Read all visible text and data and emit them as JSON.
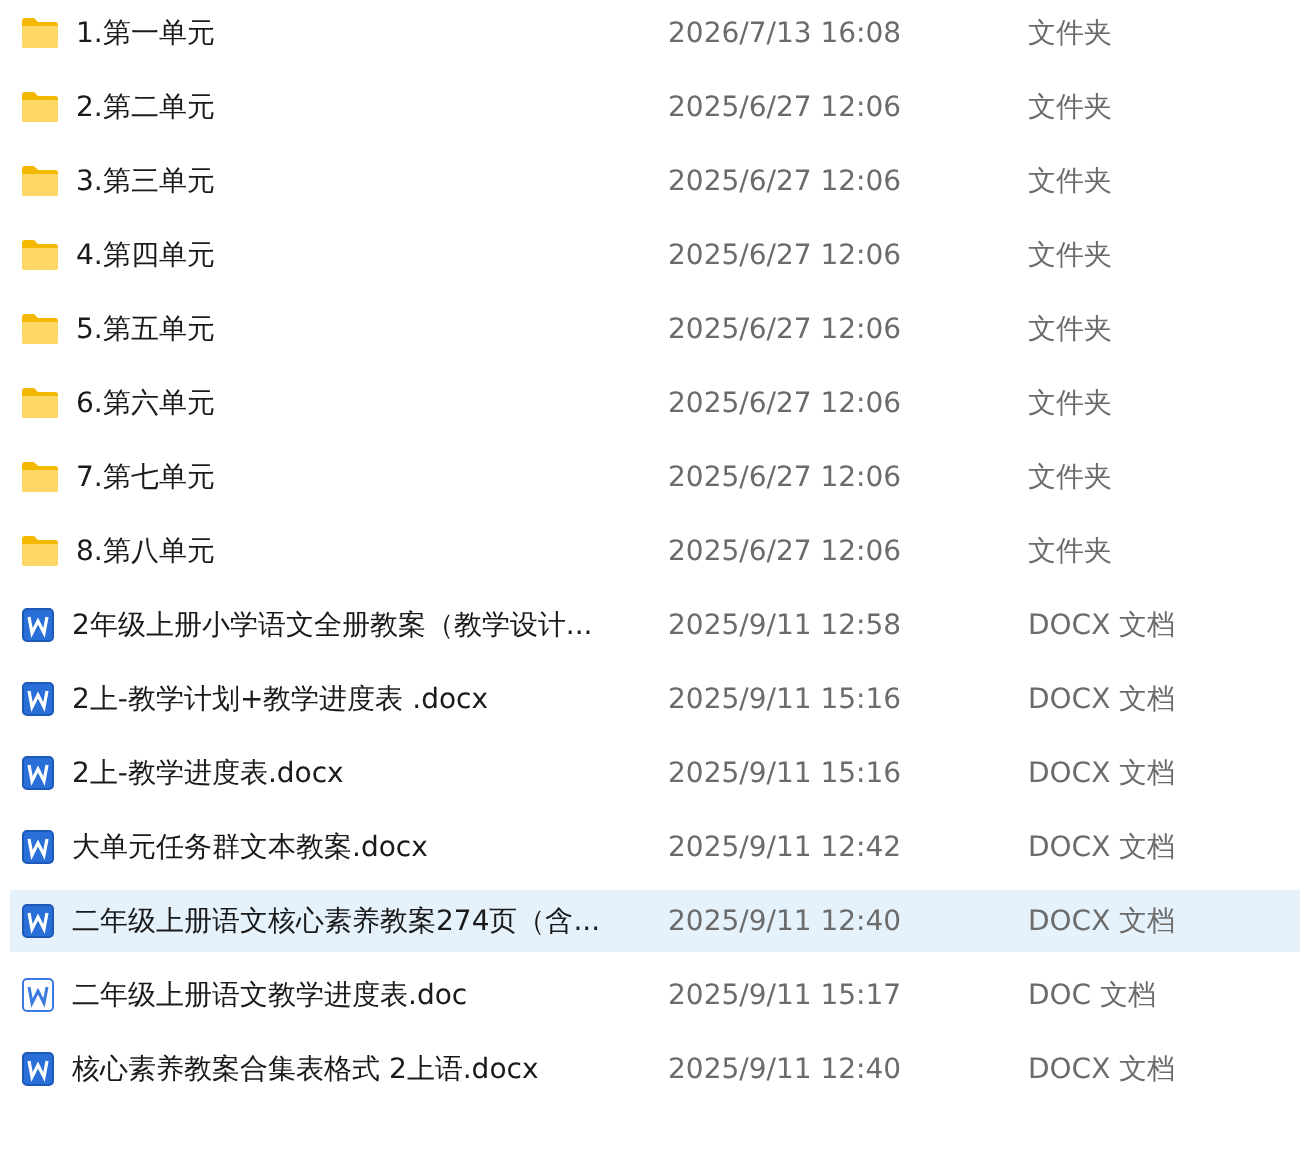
{
  "files": [
    {
      "kind": "folder",
      "name": "1.第一单元",
      "modified": "2026/7/13 16:08",
      "type": "文件夹",
      "selected": false
    },
    {
      "kind": "folder",
      "name": "2.第二单元",
      "modified": "2025/6/27 12:06",
      "type": "文件夹",
      "selected": false
    },
    {
      "kind": "folder",
      "name": "3.第三单元",
      "modified": "2025/6/27 12:06",
      "type": "文件夹",
      "selected": false
    },
    {
      "kind": "folder",
      "name": "4.第四单元",
      "modified": "2025/6/27 12:06",
      "type": "文件夹",
      "selected": false
    },
    {
      "kind": "folder",
      "name": "5.第五单元",
      "modified": "2025/6/27 12:06",
      "type": "文件夹",
      "selected": false
    },
    {
      "kind": "folder",
      "name": "6.第六单元",
      "modified": "2025/6/27 12:06",
      "type": "文件夹",
      "selected": false
    },
    {
      "kind": "folder",
      "name": "7.第七单元",
      "modified": "2025/6/27 12:06",
      "type": "文件夹",
      "selected": false
    },
    {
      "kind": "folder",
      "name": "8.第八单元",
      "modified": "2025/6/27 12:06",
      "type": "文件夹",
      "selected": false
    },
    {
      "kind": "docx",
      "name": "2年级上册小学语文全册教案（教学设计...",
      "modified": "2025/9/11 12:58",
      "type": "DOCX 文档",
      "selected": false
    },
    {
      "kind": "docx",
      "name": "2上-教学计划+教学进度表 .docx",
      "modified": "2025/9/11 15:16",
      "type": "DOCX 文档",
      "selected": false
    },
    {
      "kind": "docx",
      "name": "2上-教学进度表.docx",
      "modified": "2025/9/11 15:16",
      "type": "DOCX 文档",
      "selected": false
    },
    {
      "kind": "docx",
      "name": "大单元任务群文本教案.docx",
      "modified": "2025/9/11 12:42",
      "type": "DOCX 文档",
      "selected": false
    },
    {
      "kind": "docx",
      "name": "二年级上册语文核心素养教案274页（含...",
      "modified": "2025/9/11 12:40",
      "type": "DOCX 文档",
      "selected": true
    },
    {
      "kind": "doc",
      "name": "二年级上册语文教学进度表.doc",
      "modified": "2025/9/11 15:17",
      "type": "DOC 文档",
      "selected": false
    },
    {
      "kind": "docx",
      "name": "核心素养教案合集表格式 2上语.docx",
      "modified": "2025/9/11 12:40",
      "type": "DOCX 文档",
      "selected": false
    }
  ]
}
